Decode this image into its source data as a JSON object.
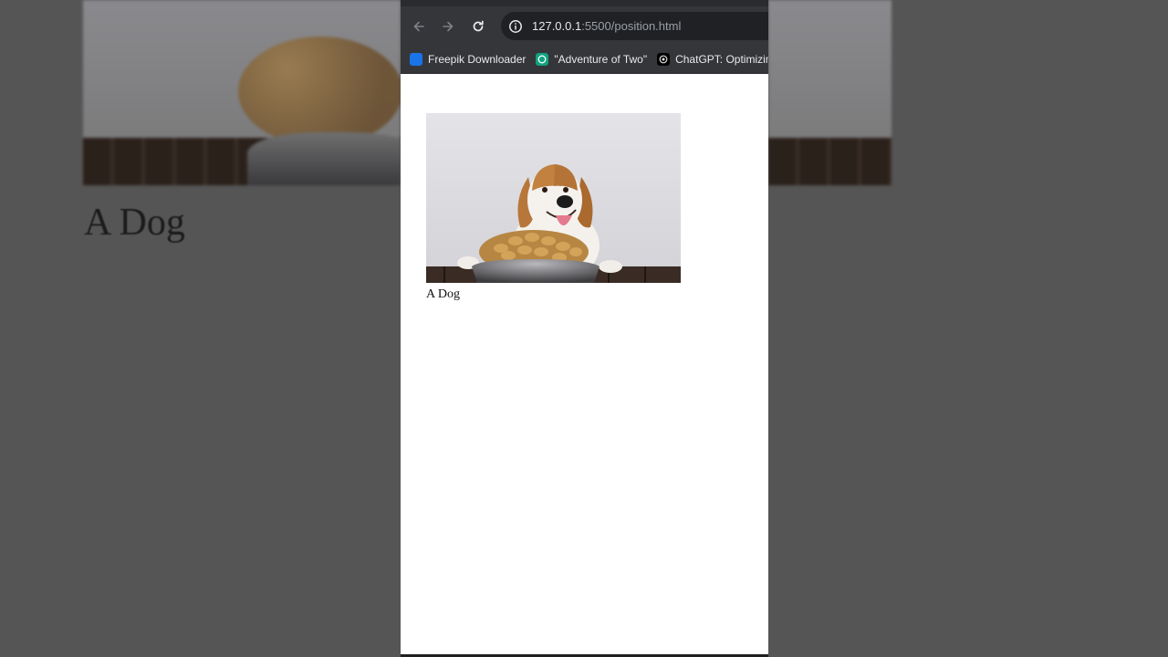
{
  "background": {
    "title": "A Dog"
  },
  "browser": {
    "url_host": "127.0.0.1",
    "url_rest": ":5500/position.html",
    "bookmarks": [
      {
        "label": "Freepik Downloader",
        "icon": "freepik-icon",
        "color": "#1a73e8"
      },
      {
        "label": "\"Adventure of Two\"",
        "icon": "chatgpt-icon",
        "color": "#10a37f"
      },
      {
        "label": "ChatGPT: Optimizin...",
        "icon": "openai-icon",
        "color": "#000000"
      }
    ]
  },
  "page": {
    "image_alt": "dog-with-food-bowl",
    "caption": "A Dog"
  },
  "colors": {
    "toolbar": "#35363a",
    "omnibox": "#202124",
    "page_bg": "#ffffff"
  }
}
